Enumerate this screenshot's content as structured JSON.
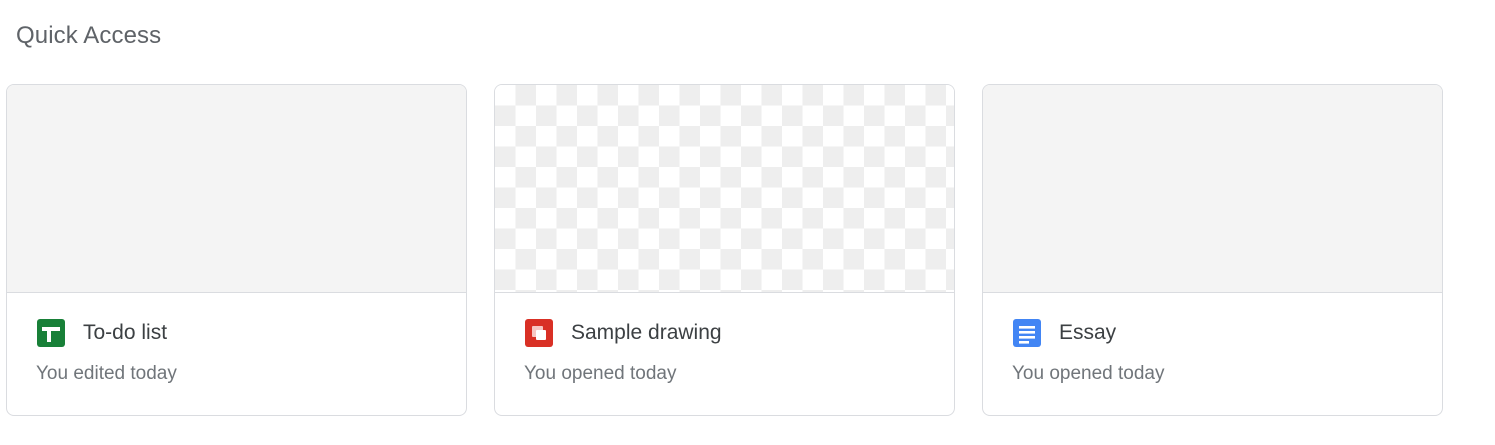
{
  "section": {
    "title": "Quick Access"
  },
  "cards": [
    {
      "name": "To-do list",
      "subtitle": "You edited today",
      "icon": "sheets-icon",
      "icon_color": "#188038"
    },
    {
      "name": "Sample drawing",
      "subtitle": "You opened today",
      "icon": "drawings-icon",
      "icon_color": "#d93025"
    },
    {
      "name": "Essay",
      "subtitle": "You opened today",
      "icon": "docs-icon",
      "icon_color": "#4285f4"
    }
  ]
}
